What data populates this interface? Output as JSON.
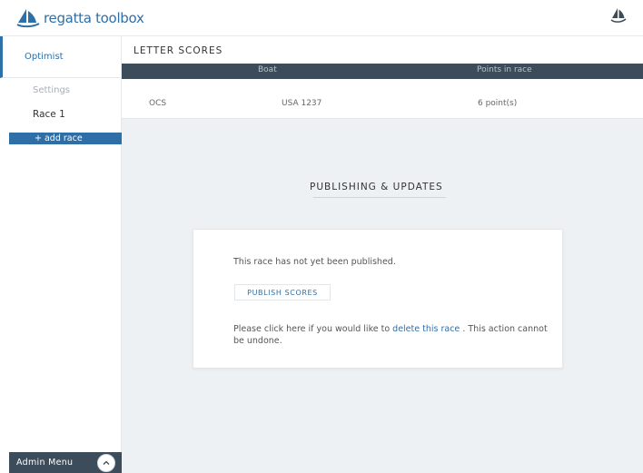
{
  "app": {
    "title": "regatta toolbox",
    "brand_color": "#2f6fa8",
    "dark_color": "#3d4c5a",
    "logo_icon": "sailboat-logo-icon",
    "corner_icon": "sailboat-icon"
  },
  "sidebar": {
    "class_name": "Optimist",
    "settings_label": "Settings",
    "race_label": "Race 1",
    "add_race_label": "+ add race",
    "admin_menu_label": "Admin Menu",
    "toggle_icon": "chevron-up-icon"
  },
  "letter_scores": {
    "title": "LETTER SCORES",
    "columns": [
      "",
      "Boat",
      "Points in race"
    ],
    "rows": [
      {
        "letter": "OCS",
        "boat": "USA 1237",
        "points": "6 point(s)"
      }
    ]
  },
  "publishing": {
    "title": "PUBLISHING & UPDATES",
    "status_message": "This race has not yet been published.",
    "publish_button": "PUBLISH SCORES",
    "delete_prefix": "Please click here if you would like to",
    "delete_link": "delete this race",
    "delete_suffix": ". This action cannot be undone."
  }
}
